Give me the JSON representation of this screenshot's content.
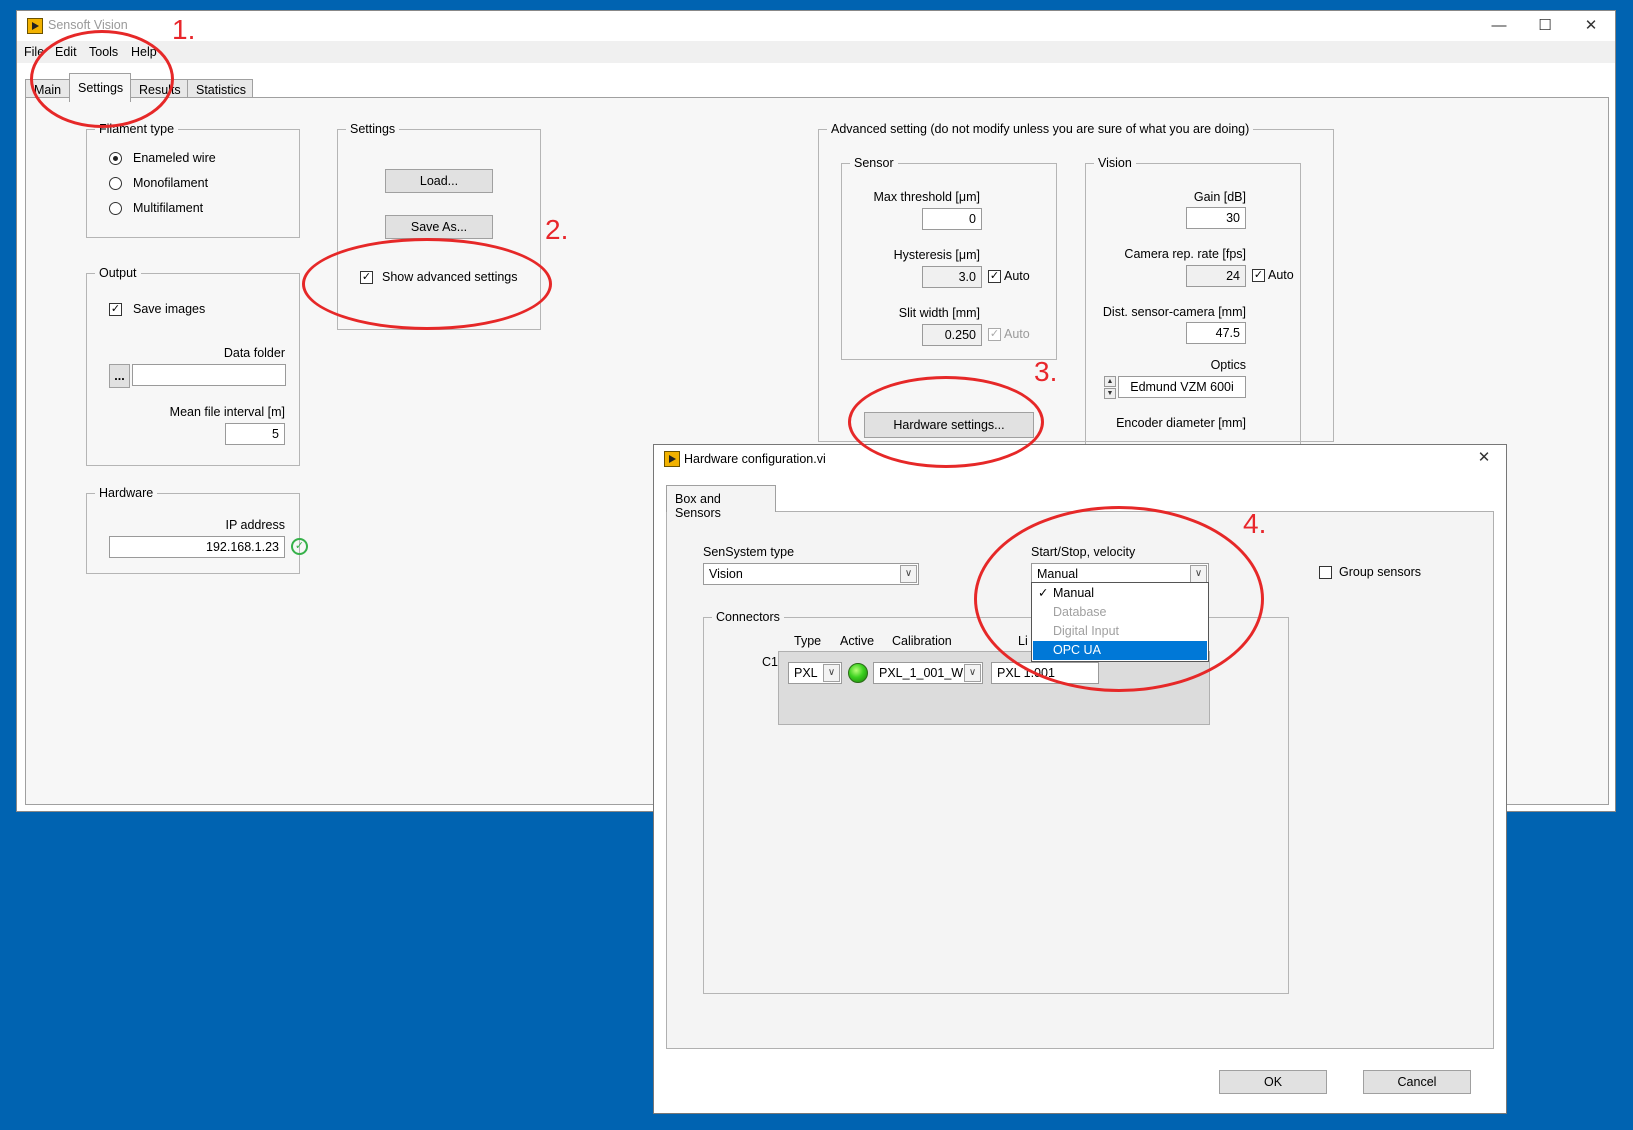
{
  "main_window": {
    "title": "Sensoft Vision",
    "controls": {
      "minimize": "—",
      "maximize": "☐",
      "close": "✕"
    },
    "menu": [
      "File",
      "Edit",
      "Tools",
      "Help"
    ],
    "tabs": [
      "Main",
      "Settings",
      "Results",
      "Statistics"
    ],
    "active_tab": "Settings"
  },
  "filament_type": {
    "legend": "Filament type",
    "options": [
      "Enameled wire",
      "Monofilament",
      "Multifilament"
    ],
    "selected": "Enameled wire"
  },
  "output": {
    "legend": "Output",
    "save_images_label": "Save images",
    "save_images_checked": true,
    "data_folder_label": "Data folder",
    "browse_label": "...",
    "data_folder_value": "",
    "mean_interval_label": "Mean file interval [m]",
    "mean_interval_value": "5"
  },
  "hardware": {
    "legend": "Hardware",
    "ip_label": "IP address",
    "ip_value": "192.168.1.23"
  },
  "settings_group": {
    "legend": "Settings",
    "load_label": "Load...",
    "save_as_label": "Save As...",
    "show_advanced_label": "Show advanced settings",
    "show_advanced_checked": true
  },
  "advanced": {
    "legend": "Advanced setting (do not modify unless you are sure of what you are doing)",
    "sensor": {
      "legend": "Sensor",
      "max_threshold_label": "Max threshold [μm]",
      "max_threshold_value": "0",
      "hysteresis_label": "Hysteresis [μm]",
      "hysteresis_value": "3.0",
      "hysteresis_auto_label": "Auto",
      "slit_width_label": "Slit width [mm]",
      "slit_width_value": "0.250",
      "slit_width_auto_label": "Auto"
    },
    "vision": {
      "legend": "Vision",
      "gain_label": "Gain [dB]",
      "gain_value": "30",
      "camera_rate_label": "Camera rep. rate [fps]",
      "camera_rate_value": "24",
      "camera_rate_auto_label": "Auto",
      "dist_label": "Dist. sensor-camera [mm]",
      "dist_value": "47.5",
      "optics_label": "Optics",
      "optics_value": "Edmund VZM 600i",
      "encoder_label": "Encoder diameter [mm]"
    },
    "hardware_settings_label": "Hardware settings..."
  },
  "annotations": [
    "1.",
    "2.",
    "3.",
    "4."
  ],
  "dialog": {
    "title": "Hardware configuration.vi",
    "close": "✕",
    "tab": "Box and Sensors",
    "sensystem_label": "SenSystem type",
    "sensystem_value": "Vision",
    "startstop_label": "Start/Stop, velocity",
    "startstop_value": "Manual",
    "startstop_options": [
      {
        "label": "Manual",
        "state": "checked"
      },
      {
        "label": "Database",
        "state": "disabled"
      },
      {
        "label": "Digital Input",
        "state": "disabled"
      },
      {
        "label": "OPC UA",
        "state": "highlighted"
      }
    ],
    "group_sensors_label": "Group sensors",
    "group_sensors_checked": false,
    "connectors_legend": "Connectors",
    "connector_headers": {
      "type": "Type",
      "active": "Active",
      "calibration": "Calibration",
      "li": "Li"
    },
    "connector_row": {
      "name": "C1",
      "type": "PXL",
      "calibration": "PXL_1_001_W",
      "li_value": "PXL 1.001"
    },
    "ok_label": "OK",
    "cancel_label": "Cancel"
  }
}
